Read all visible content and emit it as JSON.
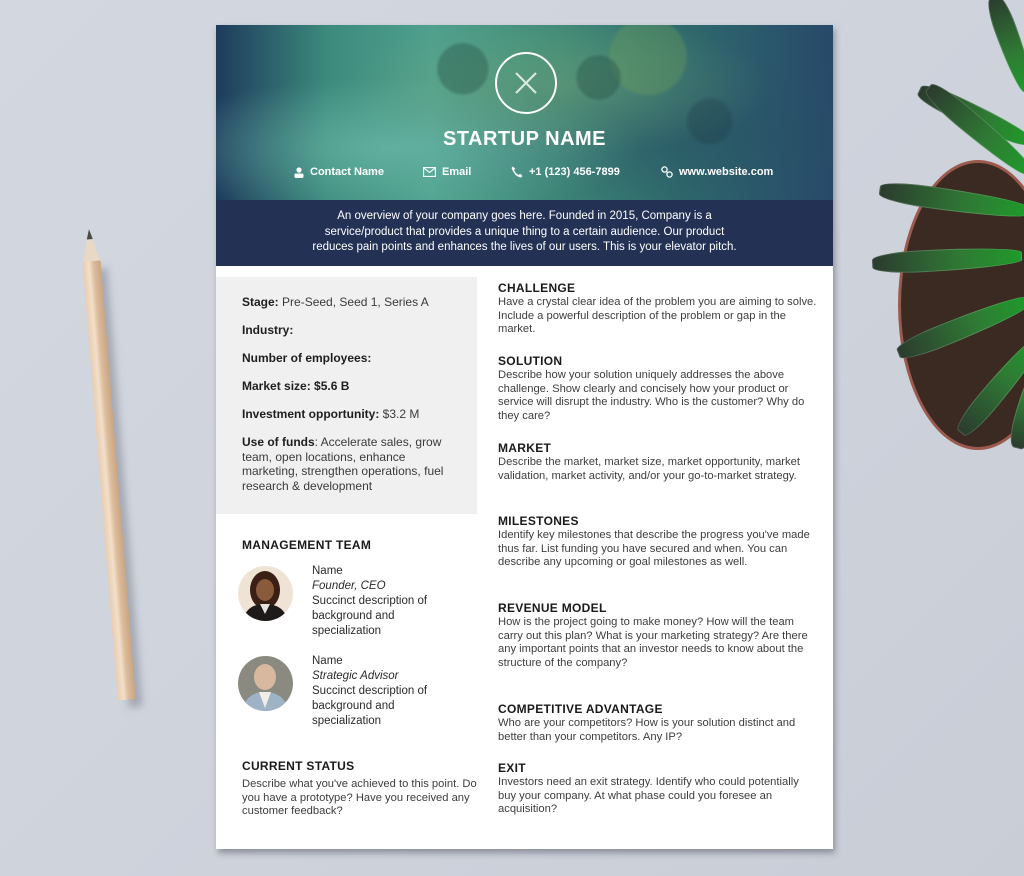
{
  "header": {
    "startup_name": "STARTUP NAME",
    "logo_icon": "x-circle-logo-icon",
    "contacts": [
      {
        "icon": "person-icon",
        "label": "Contact Name"
      },
      {
        "icon": "envelope-icon",
        "label": "Email"
      },
      {
        "icon": "phone-icon",
        "label": "+1 (123) 456-7899"
      },
      {
        "icon": "link-icon",
        "label": "www.website.com"
      }
    ]
  },
  "overview": {
    "line1": "An overview of your company goes here. Founded in 2015, Company is a",
    "line2": "service/product that provides a unique thing to a certain audience. Our product",
    "line3": "reduces pain points and enhances the lives of our users. This is your elevator pitch."
  },
  "facts": [
    {
      "key": "Stage:",
      "value": " Pre-Seed, Seed 1, Series A"
    },
    {
      "key": "Industry:",
      "value": ""
    },
    {
      "key": "Number of employees:",
      "value": ""
    },
    {
      "key": "Market size: $5.6 B",
      "value": ""
    },
    {
      "key": "Investment opportunity:",
      "value": " $3.2 M"
    },
    {
      "key": "Use of funds",
      "value": ": Accelerate sales, grow team, open locations, enhance marketing, strengthen operations, fuel research & development"
    }
  ],
  "management": {
    "title": "MANAGEMENT TEAM",
    "members": [
      {
        "name": "Name",
        "role": "Founder, CEO",
        "desc1": "Succinct description of",
        "desc2": "background and",
        "desc3": "specialization"
      },
      {
        "name": "Name",
        "role": "Strategic Advisor",
        "desc1": "Succinct description of",
        "desc2": "background and",
        "desc3": "specialization"
      }
    ]
  },
  "current_status": {
    "title": "CURRENT STATUS",
    "text": "Describe what you've achieved to this point. Do you have a prototype? Have you received any customer feedback?"
  },
  "sections": [
    {
      "title": "CHALLENGE",
      "text": "Have a crystal clear idea of the problem you are aiming to solve. Include a powerful description of the problem or gap in the market."
    },
    {
      "title": "SOLUTION",
      "text": "Describe how your solution uniquely addresses the above challenge. Show clearly and concisely how your product or service will disrupt the industry. Who is the customer? Why do they care?"
    },
    {
      "title": "MARKET",
      "text": "Describe the market, market size, market opportunity, market validation, market activity, and/or your go-to-market strategy."
    },
    {
      "title": "MILESTONES",
      "text": "Identify key milestones that describe the progress you've made thus far. List funding you have secured and when. You can describe any upcoming or goal milestones as well."
    },
    {
      "title": "REVENUE MODEL",
      "text": "How is the project going to make money? How will the team carry out this plan? What is your marketing strategy? Are there any important points that an investor needs to know about the structure of the company?"
    },
    {
      "title": "COMPETITIVE ADVANTAGE",
      "text": "Who are your competitors? How is your solution distinct and better than your competitors. Any IP?"
    },
    {
      "title": "EXIT",
      "text": "Investors need an exit strategy. Identify who could potentially buy your company. At what phase could you foresee an acquisition?"
    }
  ],
  "colors": {
    "overview_band": "#223154",
    "fact_box": "#f0f0f0",
    "background": "#d0d4dc"
  }
}
